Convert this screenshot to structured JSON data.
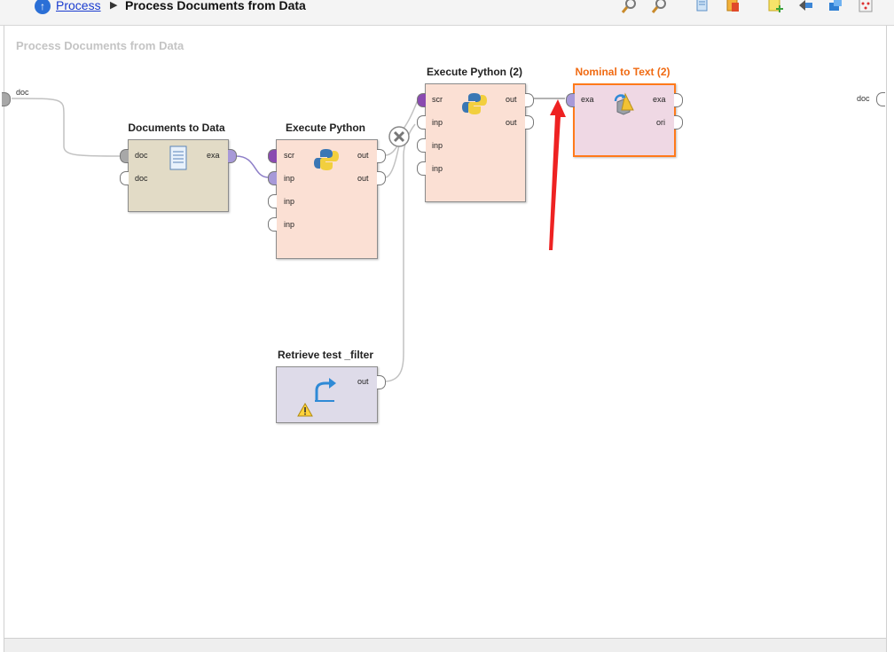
{
  "breadcrumb": {
    "parent": "Process",
    "separator": "▶",
    "current": "Process Documents from Data"
  },
  "toolbar": {
    "icons": [
      "zoom-in-icon",
      "zoom-out-icon",
      "copy-icon",
      "paste-icon",
      "add-note-icon",
      "connect-icon",
      "layers-icon",
      "auto-arrange-icon"
    ]
  },
  "canvas": {
    "title": "Process Documents from Data",
    "input_port": "doc",
    "output_port": "doc"
  },
  "operators": {
    "doc2data": {
      "title": "Documents to Data",
      "in_ports": [
        "doc",
        "doc"
      ],
      "out_ports": [
        "exa"
      ]
    },
    "python1": {
      "title": "Execute Python",
      "in_ports": [
        "scr",
        "inp",
        "inp",
        "inp"
      ],
      "out_ports": [
        "out",
        "out"
      ]
    },
    "python2": {
      "title": "Execute Python (2)",
      "in_ports": [
        "scr",
        "inp",
        "inp",
        "inp"
      ],
      "out_ports": [
        "out",
        "out"
      ]
    },
    "nom2text": {
      "title": "Nominal to Text (2)",
      "in_ports": [
        "exa"
      ],
      "out_ports": [
        "exa",
        "ori"
      ]
    },
    "retrieve": {
      "title": "Retrieve test _filter",
      "out_ports": [
        "out"
      ]
    }
  },
  "colors": {
    "highlight": "#f06a12",
    "annotation_arrow": "#ee2222",
    "link": "#1a3ccf"
  }
}
